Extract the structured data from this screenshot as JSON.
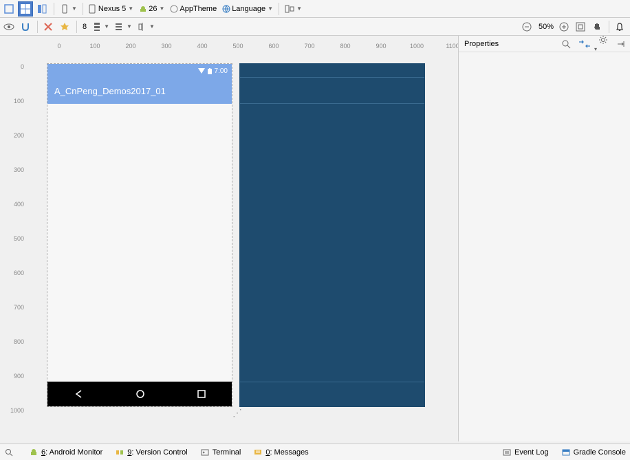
{
  "toolbar1": {
    "device": "Nexus 5",
    "apiLevel": "26",
    "theme": "AppTheme",
    "language": "Language"
  },
  "toolbar2": {
    "nestingLevel": "8",
    "zoom": "50%"
  },
  "ruler": {
    "h": [
      "0",
      "100",
      "200",
      "300",
      "400",
      "500",
      "600",
      "700",
      "800",
      "900",
      "1000",
      "1100"
    ],
    "v": [
      "0",
      "100",
      "200",
      "300",
      "400",
      "500",
      "600",
      "700",
      "800",
      "900",
      "1000"
    ]
  },
  "device": {
    "statusTime": "7:00",
    "appTitle": "A_CnPeng_Demos2017_01"
  },
  "properties": {
    "title": "Properties"
  },
  "bottom": {
    "androidMonitor": "6: Android Monitor",
    "vcs": "9: Version Control",
    "terminal": "Terminal",
    "messages": "0: Messages",
    "eventLog": "Event Log",
    "gradle": "Gradle Console"
  }
}
